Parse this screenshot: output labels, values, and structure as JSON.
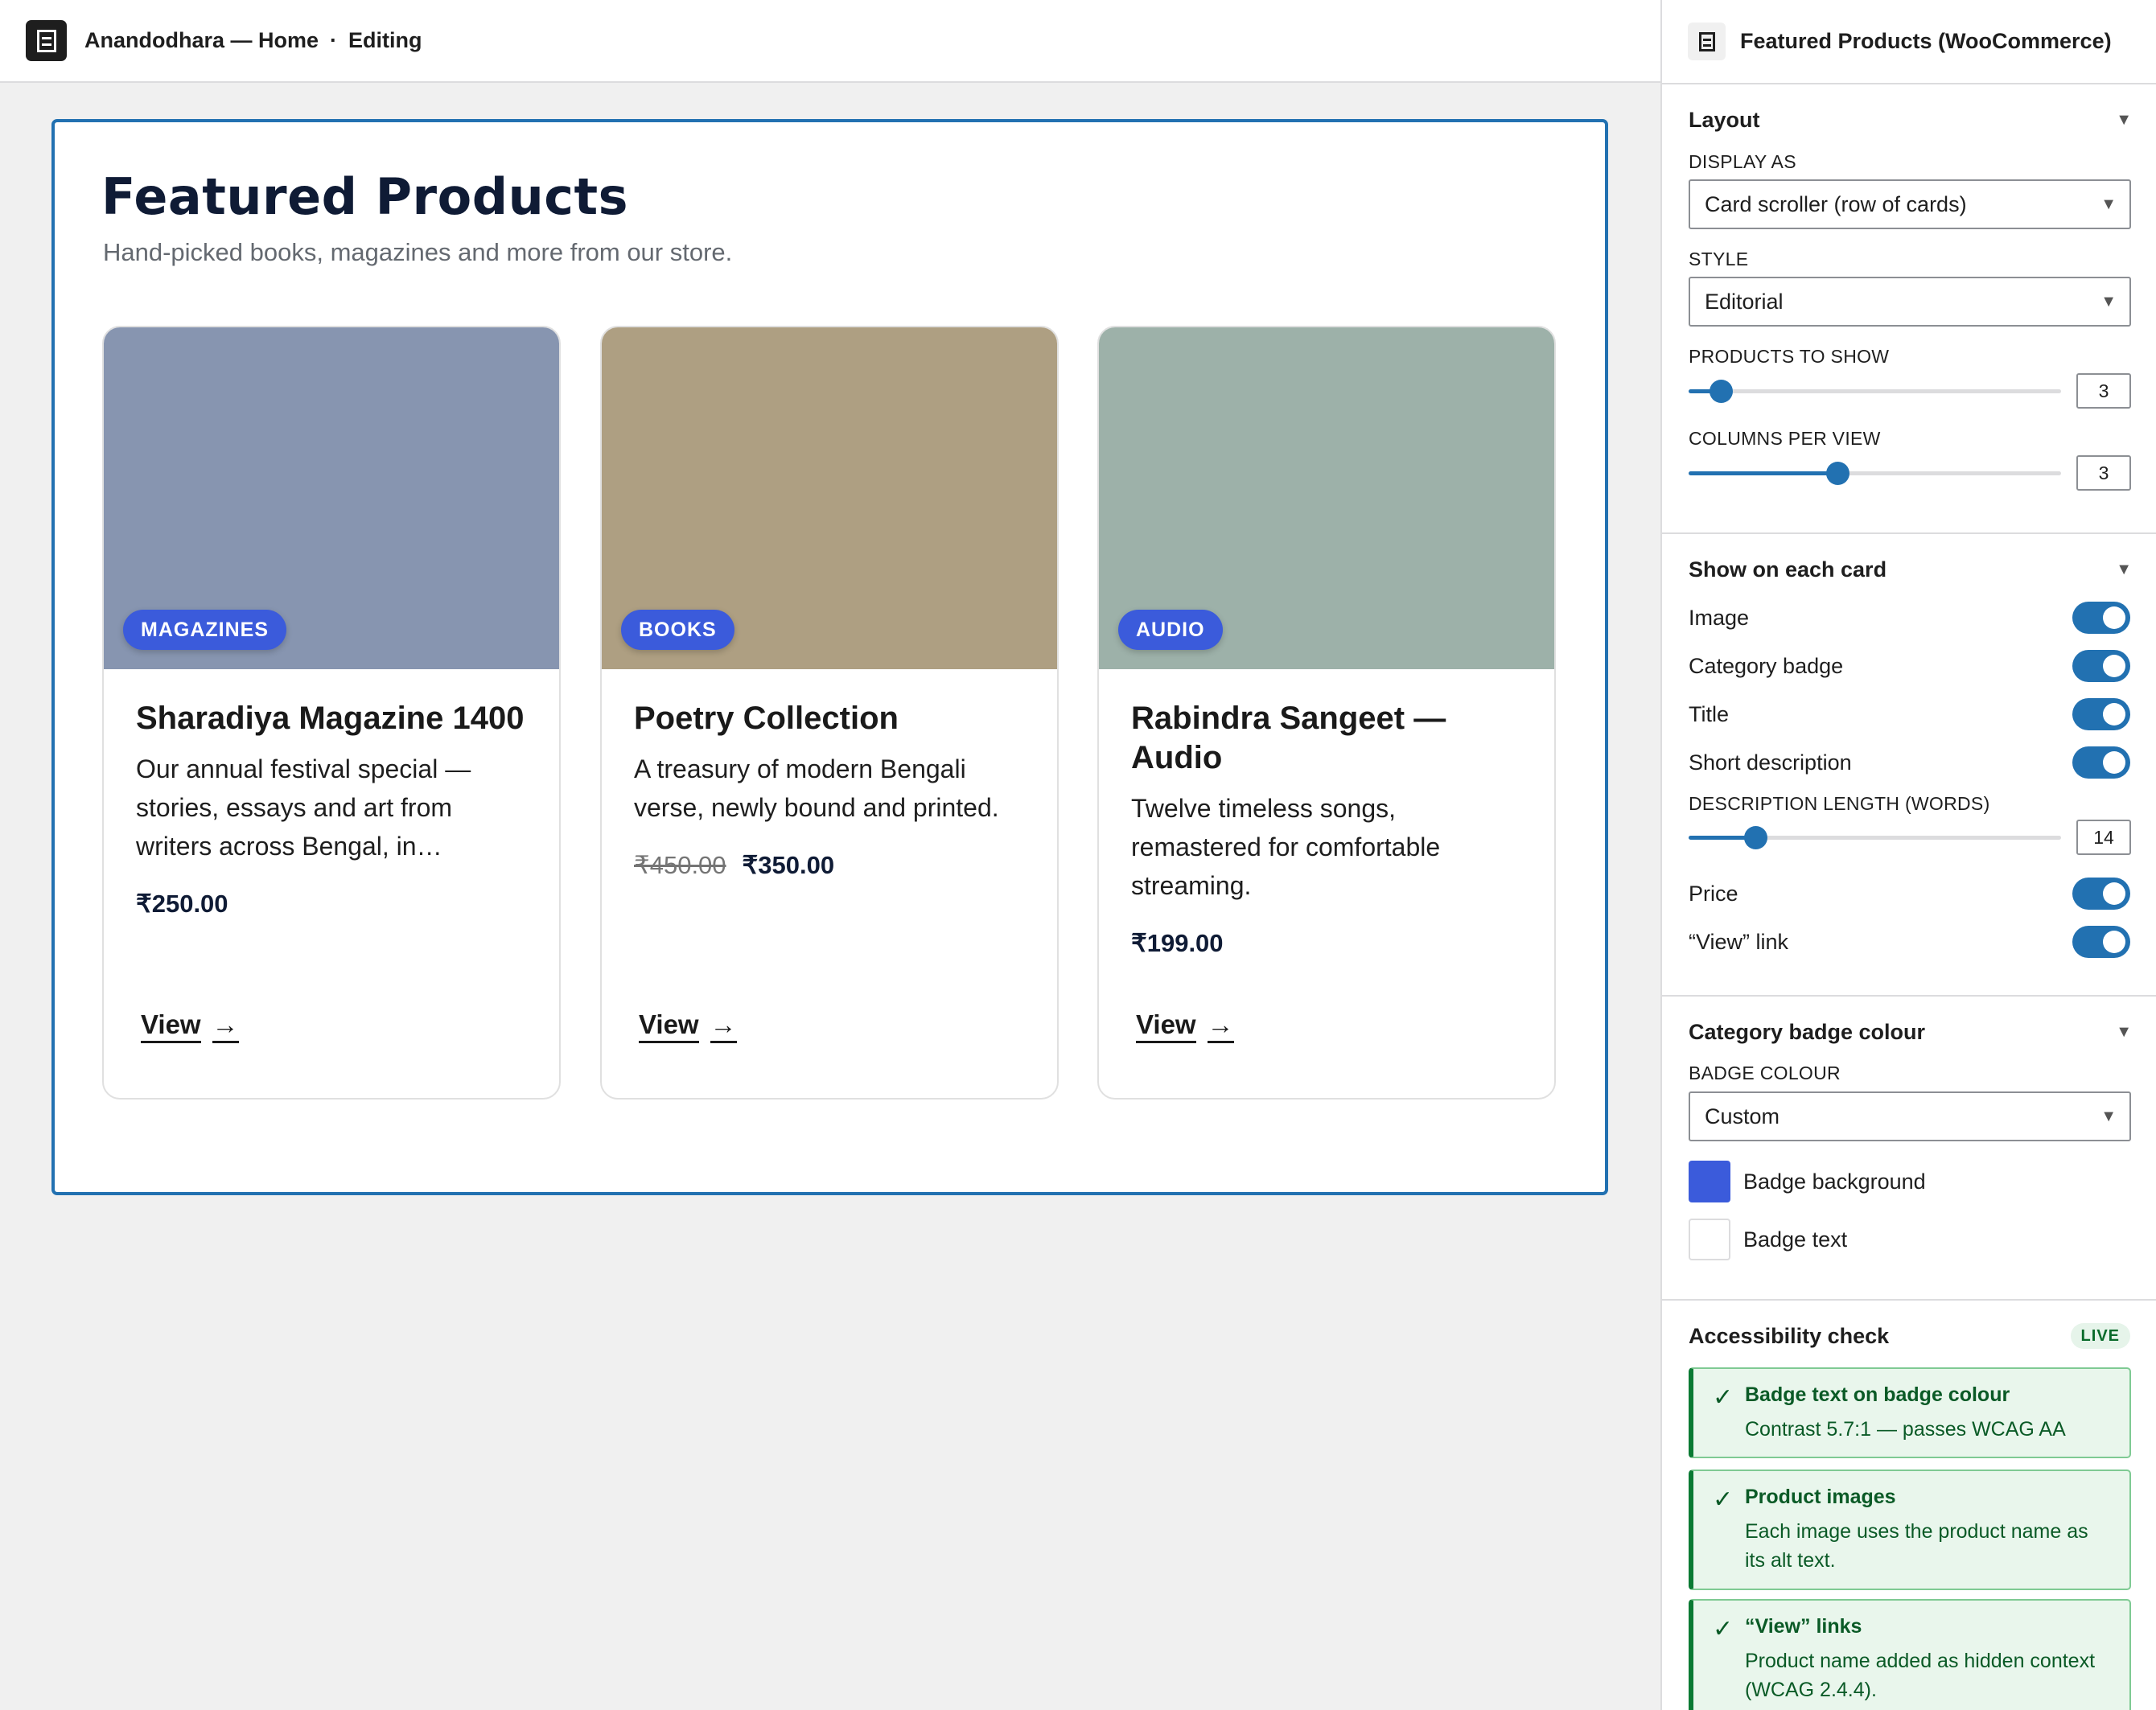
{
  "topbar": {
    "site": "Anandodhara — Home",
    "separator": "·",
    "status": "Editing"
  },
  "block": {
    "title": "Featured Products",
    "subtitle": "Hand-picked books, magazines and more from our store.",
    "cards": [
      {
        "badge": "MAGAZINES",
        "image_color": "#8795b0",
        "title": "Sharadiya Magazine 1400",
        "description": "Our annual festival special — stories, essays and art from writers across Bengal, in…",
        "price_old": "",
        "price": "₹250.00",
        "link": "View"
      },
      {
        "badge": "BOOKS",
        "image_color": "#ae9f82",
        "title": "Poetry Collection",
        "description": "A treasury of modern Bengali verse, newly bound and printed.",
        "price_old": "₹450.00",
        "price": "₹350.00",
        "link": "View"
      },
      {
        "badge": "AUDIO",
        "image_color": "#9db1a9",
        "title": "Rabindra Sangeet — Audio",
        "description": "Twelve timeless songs, remastered for comfortable streaming.",
        "price_old": "",
        "price": "₹199.00",
        "link": "View"
      }
    ],
    "link_arrow": "→"
  },
  "sidebar": {
    "title": "Featured Products (WooCommerce)",
    "layout": {
      "heading": "Layout",
      "display_as_label": "DISPLAY AS",
      "display_as_value": "Card scroller (row of cards)",
      "style_label": "STYLE",
      "style_value": "Editorial",
      "products_label": "PRODUCTS TO SHOW",
      "products_value": "3",
      "products_min": 1,
      "products_max": 24,
      "columns_label": "COLUMNS PER VIEW",
      "columns_value": "3",
      "columns_min": 1,
      "columns_max": 6
    },
    "show": {
      "heading": "Show on each card",
      "image": "Image",
      "category_badge": "Category badge",
      "title": "Title",
      "short_description": "Short description",
      "desc_length_label": "DESCRIPTION LENGTH (WORDS)",
      "desc_length_value": "14",
      "desc_length_min": 5,
      "desc_length_max": 55,
      "price": "Price",
      "view_link": "“View” link",
      "toggles_on": [
        true,
        true,
        true,
        true,
        true,
        true
      ]
    },
    "badge_colour": {
      "heading": "Category badge colour",
      "label": "BADGE COLOUR",
      "value": "Custom",
      "background_label": "Badge background",
      "background_color": "#3b5bdb",
      "text_label": "Badge text",
      "text_color": "#ffffff"
    },
    "a11y": {
      "heading": "Accessibility check",
      "live": "LIVE",
      "checks": [
        {
          "title": "Badge text on badge colour",
          "detail": "Contrast 5.7:1 — passes WCAG AA"
        },
        {
          "title": "Product images",
          "detail": "Each image uses the product name as its alt text."
        },
        {
          "title": "“View” links",
          "detail": "Product name added as hidden context (WCAG 2.4.4)."
        }
      ]
    }
  },
  "colors": {
    "accent": "#2271b1",
    "badge_bg": "#3b5bdb",
    "badge_fg": "#ffffff",
    "heading": "#0f1b35",
    "success": "#0a7a33"
  },
  "icons": {
    "app": "document-icon",
    "block": "document-icon",
    "chevron": "chevron-down-icon",
    "check": "check-icon",
    "arrow": "arrow-right-icon"
  }
}
